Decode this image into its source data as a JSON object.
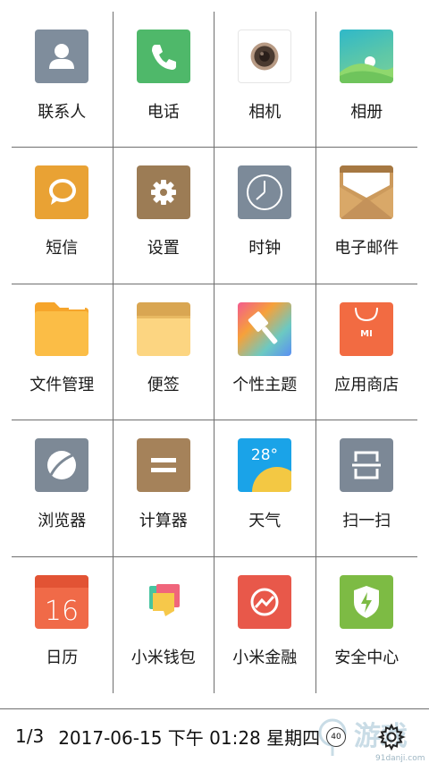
{
  "apps": [
    {
      "label": "联系人",
      "icon": "contacts-icon"
    },
    {
      "label": "电话",
      "icon": "phone-icon"
    },
    {
      "label": "相机",
      "icon": "camera-icon"
    },
    {
      "label": "相册",
      "icon": "gallery-icon"
    },
    {
      "label": "短信",
      "icon": "messages-icon"
    },
    {
      "label": "设置",
      "icon": "settings-icon"
    },
    {
      "label": "时钟",
      "icon": "clock-icon"
    },
    {
      "label": "电子邮件",
      "icon": "email-icon"
    },
    {
      "label": "文件管理",
      "icon": "file-manager-icon"
    },
    {
      "label": "便签",
      "icon": "notes-icon"
    },
    {
      "label": "个性主题",
      "icon": "themes-icon"
    },
    {
      "label": "应用商店",
      "icon": "app-store-icon"
    },
    {
      "label": "浏览器",
      "icon": "browser-icon"
    },
    {
      "label": "计算器",
      "icon": "calculator-icon"
    },
    {
      "label": "天气",
      "icon": "weather-icon"
    },
    {
      "label": "扫一扫",
      "icon": "scanner-icon"
    },
    {
      "label": "日历",
      "icon": "calendar-icon"
    },
    {
      "label": "小米钱包",
      "icon": "wallet-icon"
    },
    {
      "label": "小米金融",
      "icon": "finance-icon"
    },
    {
      "label": "安全中心",
      "icon": "security-icon"
    }
  ],
  "icon_text": {
    "store_mark": "MI",
    "weather_temp": "28°",
    "calendar_day": "16"
  },
  "status": {
    "page": "1/3",
    "datetime": "2017-06-15 下午 01:28 星期四",
    "badge": "40",
    "watermark": "91danji.com",
    "watermark_logo": "游戏"
  },
  "colors": {
    "grid_line": "#6f6f6f",
    "background": "#ffffff"
  }
}
